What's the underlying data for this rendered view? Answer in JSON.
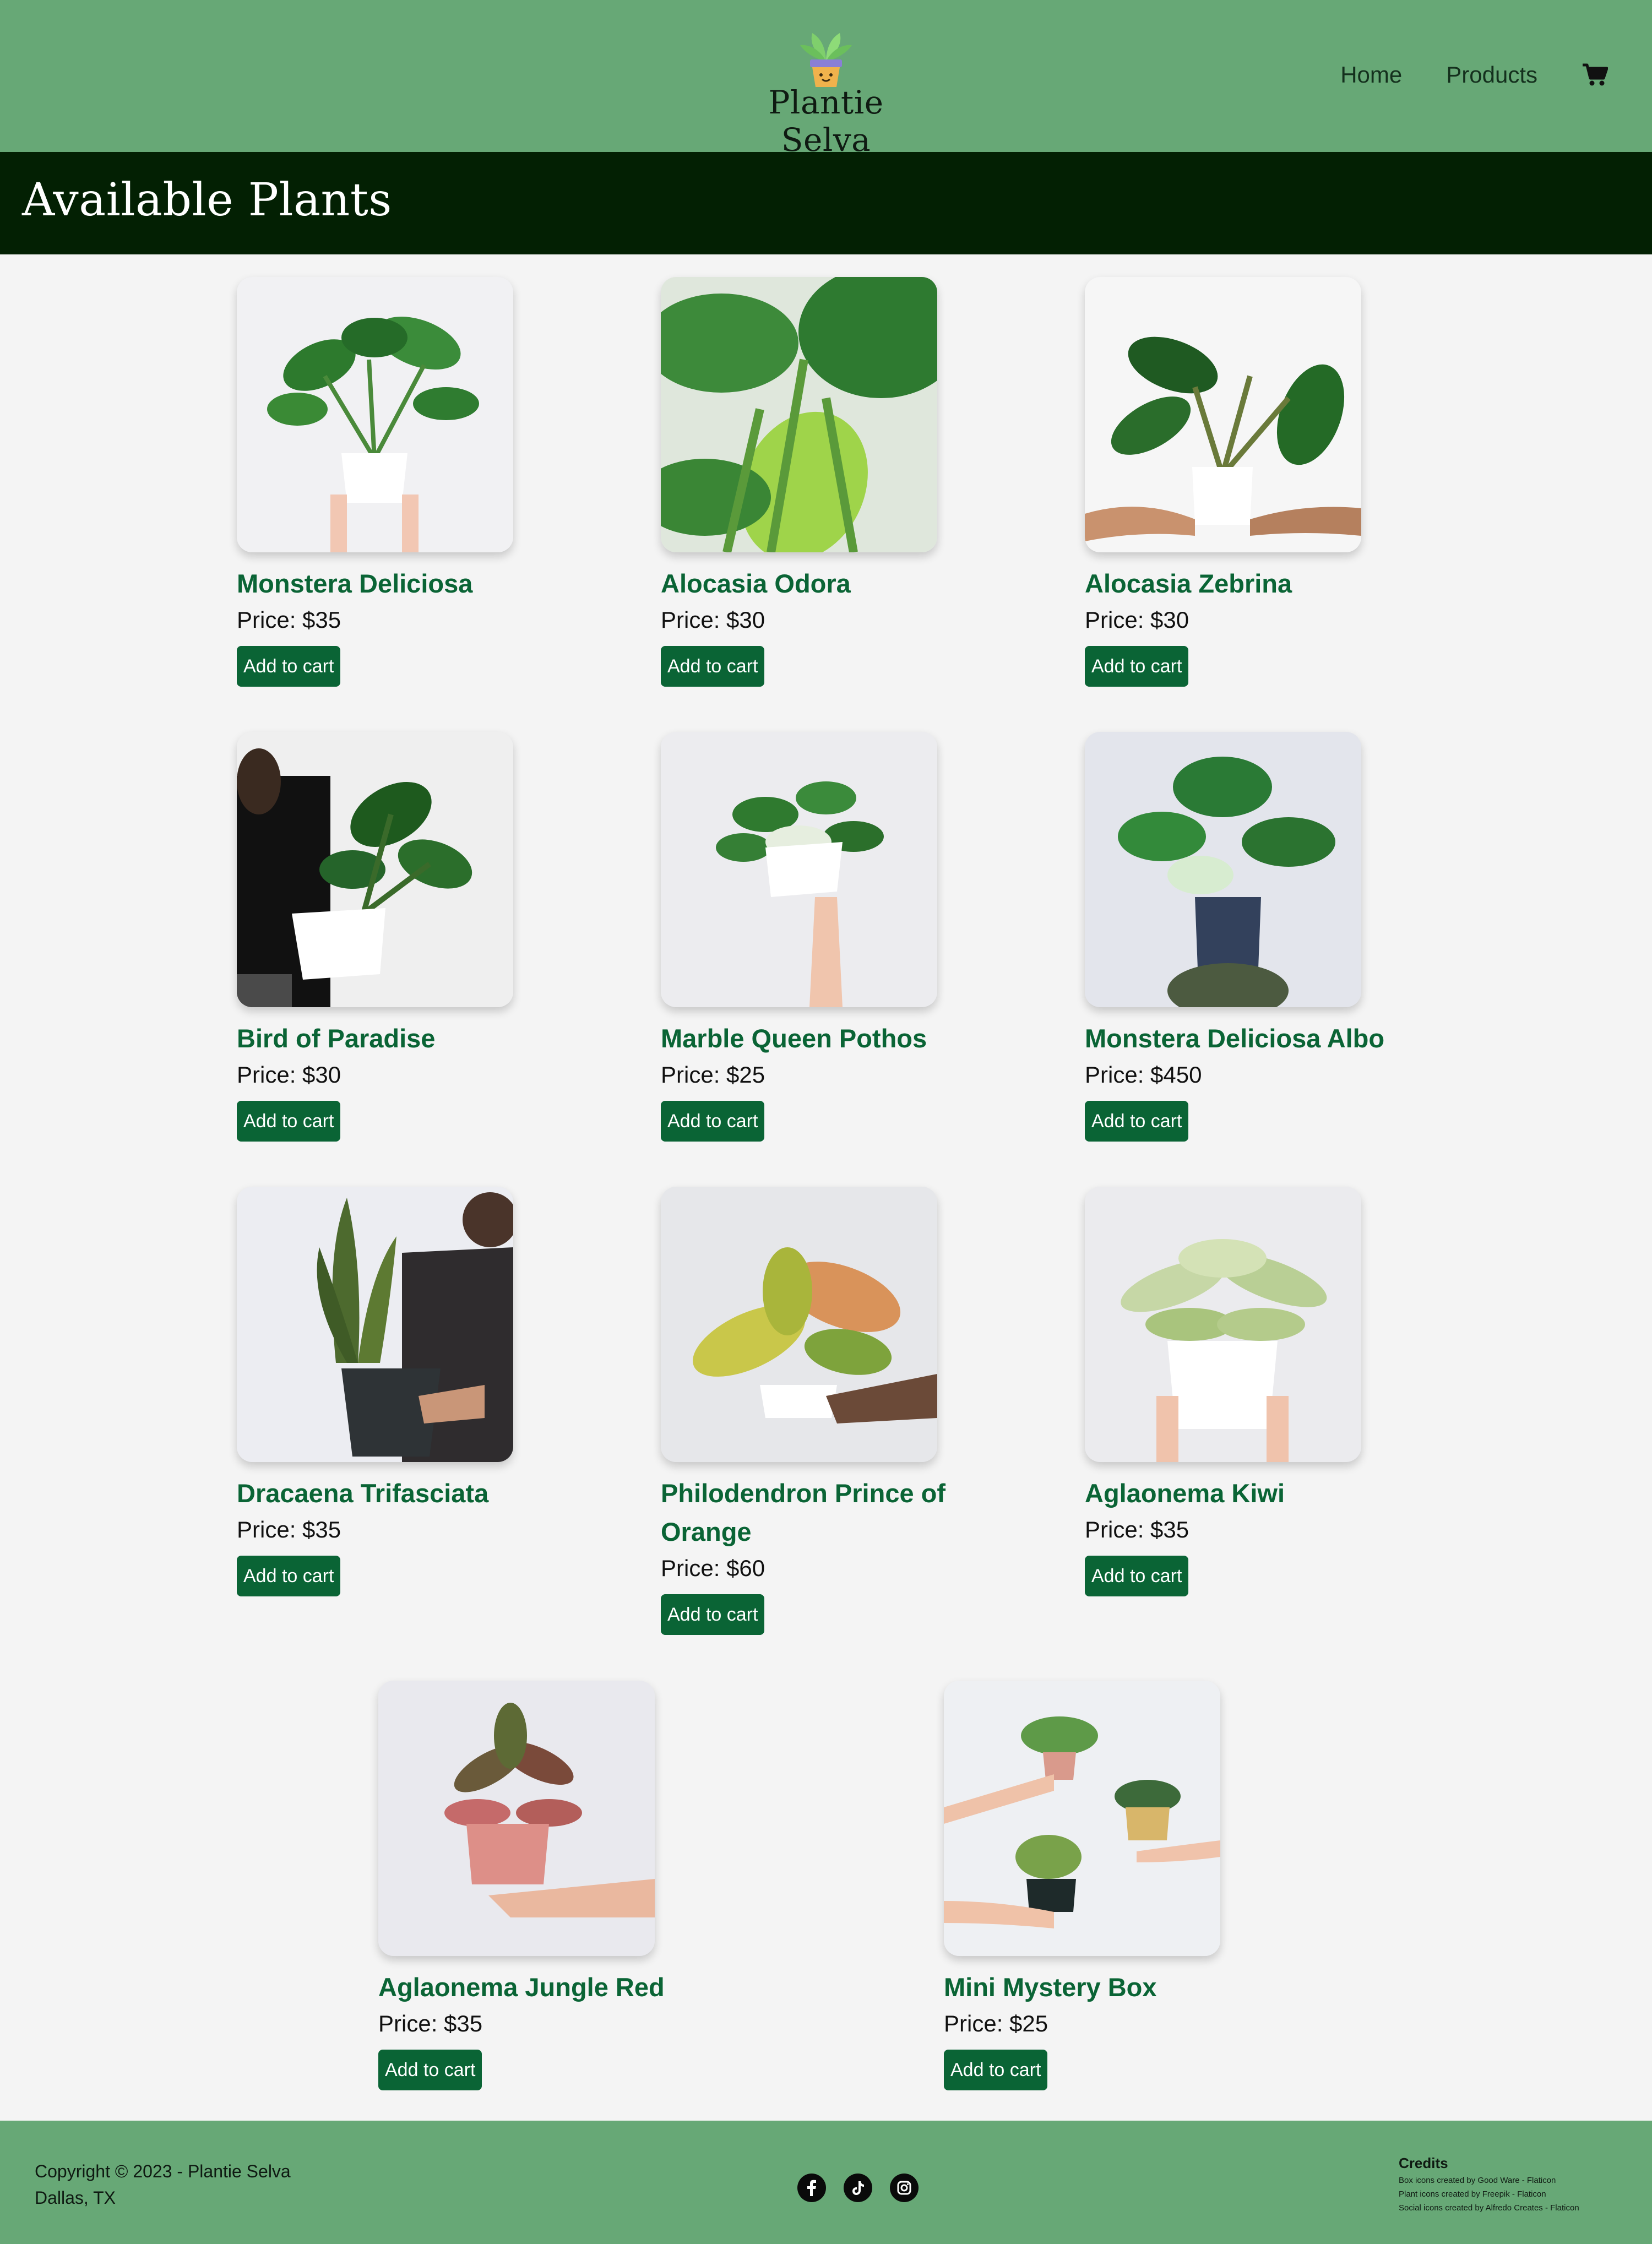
{
  "header": {
    "brand": "Plantie Selva",
    "nav": [
      {
        "label": "Home"
      },
      {
        "label": "Products"
      }
    ],
    "cart_icon": "shopping-cart-icon"
  },
  "page_title": "Available Plants",
  "products": [
    {
      "name": "Monstera Deliciosa",
      "price": "Price: $35",
      "button": "Add to cart"
    },
    {
      "name": "Alocasia Odora",
      "price": "Price: $30",
      "button": "Add to cart"
    },
    {
      "name": "Alocasia Zebrina",
      "price": "Price: $30",
      "button": "Add to cart"
    },
    {
      "name": "Bird of Paradise",
      "price": "Price: $30",
      "button": "Add to cart"
    },
    {
      "name": "Marble Queen Pothos",
      "price": "Price: $25",
      "button": "Add to cart"
    },
    {
      "name": "Monstera Deliciosa Albo",
      "price": "Price: $450",
      "button": "Add to cart"
    },
    {
      "name": "Dracaena Trifasciata",
      "price": "Price: $35",
      "button": "Add to cart"
    },
    {
      "name": "Philodendron Prince of Orange",
      "price": "Price: $60",
      "button": "Add to cart"
    },
    {
      "name": "Aglaonema Kiwi",
      "price": "Price: $35",
      "button": "Add to cart"
    },
    {
      "name": "Aglaonema Jungle Red",
      "price": "Price: $35",
      "button": "Add to cart"
    },
    {
      "name": "Mini Mystery Box",
      "price": "Price: $25",
      "button": "Add to cart"
    }
  ],
  "footer": {
    "copyright": "Copyright © 2023 - Plantie Selva",
    "location": "Dallas, TX",
    "socials": [
      "facebook-icon",
      "tiktok-icon",
      "instagram-icon"
    ],
    "credits_title": "Credits",
    "credits": [
      "Box icons created by Good Ware - Flaticon",
      "Plant icons created by Freepik - Flaticon",
      "Social icons created by Alfredo Creates - Flaticon"
    ]
  },
  "colors": {
    "header_bg": "#67a876",
    "title_band_bg": "#032003",
    "accent_green": "#0a6435",
    "page_bg": "#f4f4f4"
  }
}
